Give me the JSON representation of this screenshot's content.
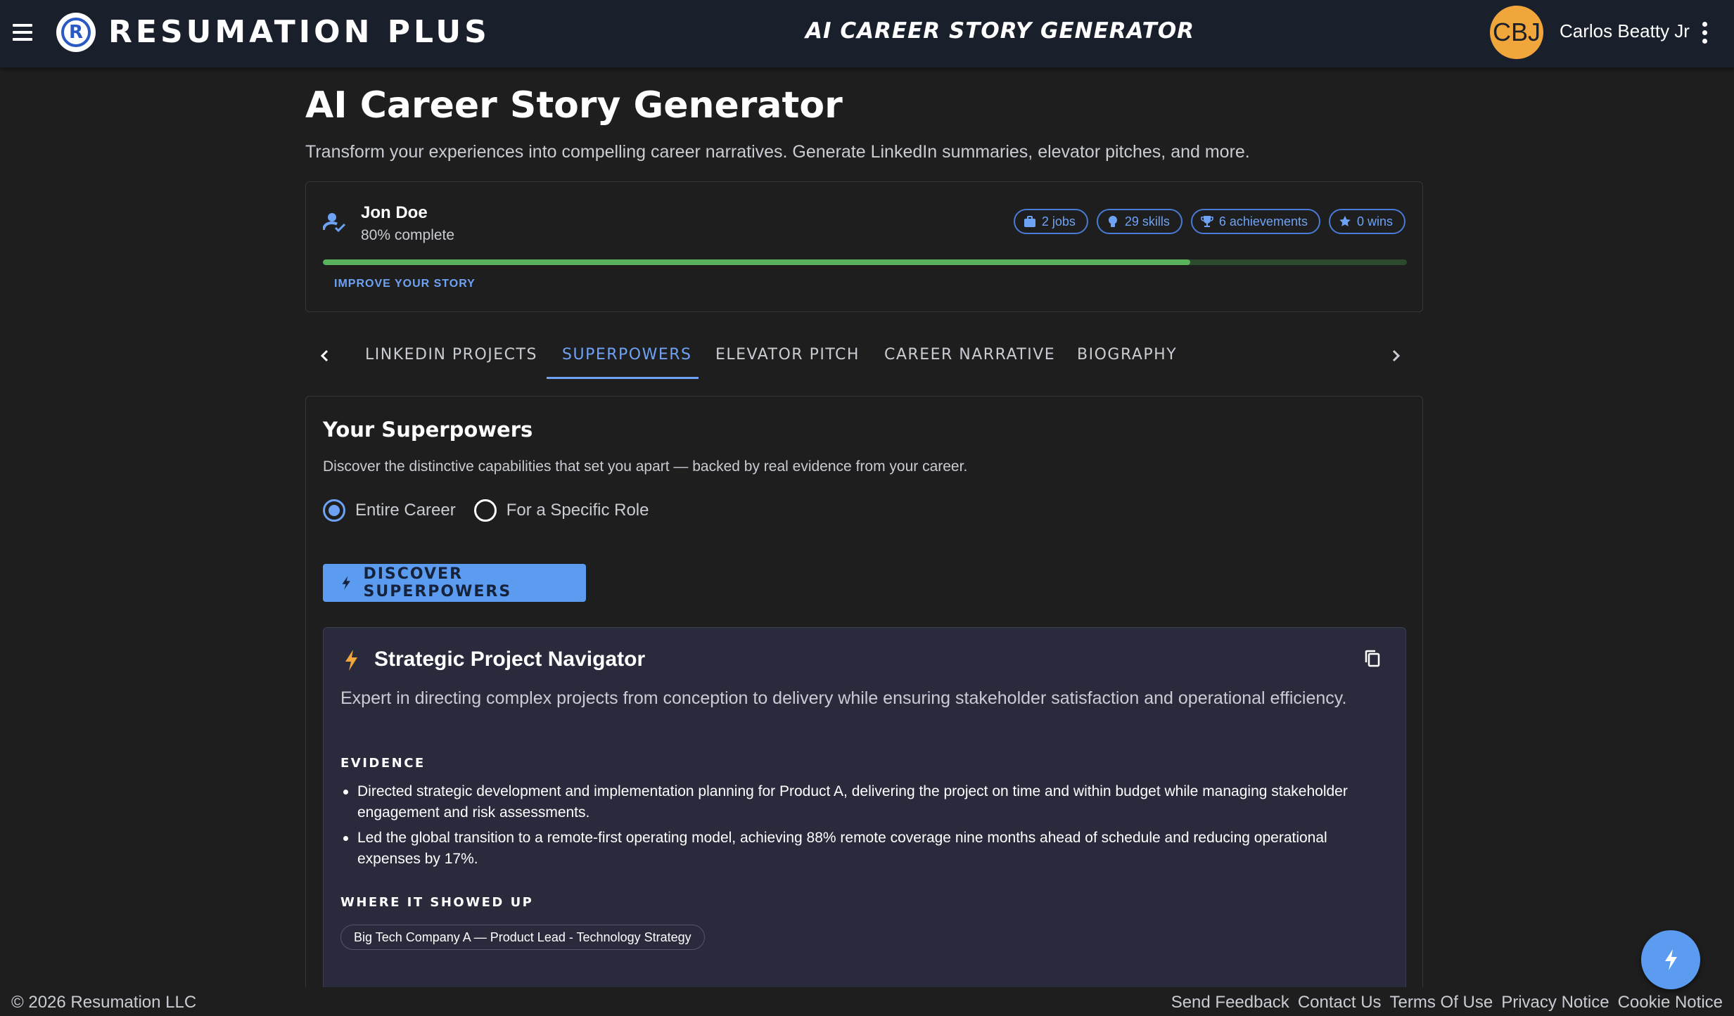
{
  "appbar": {
    "brand": "RESUMATION PLUS",
    "logo_letter": "R",
    "center_title": "AI CAREER STORY GENERATOR",
    "avatar_initials": "CBJ",
    "user_name": "Carlos Beatty Jr",
    "colors": {
      "bar": "#1a1f2c",
      "avatar": "#f0a63a",
      "logo_ring": "#2b59c3"
    },
    "icons": [
      "hamburger-menu-icon",
      "more-vert-icon"
    ]
  },
  "header": {
    "title": "AI Career Story Generator",
    "subtitle": "Transform your experiences into compelling career narratives. Generate LinkedIn summaries, elevator pitches, and more."
  },
  "profile": {
    "name": "Jon Doe",
    "complete_label": "80% complete",
    "progress": 0.8,
    "improve_link": "IMPROVE YOUR STORY",
    "chips": [
      {
        "label": "2 jobs",
        "icon": "briefcase-icon"
      },
      {
        "label": "29 skills",
        "icon": "lightbulb-icon"
      },
      {
        "label": "6 achievements",
        "icon": "trophy-icon"
      },
      {
        "label": "0 wins",
        "icon": "star-icon"
      }
    ],
    "colors": {
      "progress_fill": "#58b35a",
      "progress_track": "#2c4a2e",
      "accent": "#6ea2f5"
    }
  },
  "tabs": {
    "items": [
      {
        "label": "LINKEDIN PROJECTS",
        "active": false
      },
      {
        "label": "SUPERPOWERS",
        "active": true
      },
      {
        "label": "ELEVATOR PITCH",
        "active": false
      },
      {
        "label": "CAREER NARRATIVE",
        "active": false
      },
      {
        "label": "BIOGRAPHY",
        "active": false
      }
    ]
  },
  "superpowers": {
    "title": "Your Superpowers",
    "description": "Discover the distinctive capabilities that set you apart — backed by real evidence from your career.",
    "radio_options": [
      {
        "label": "Entire Career",
        "checked": true
      },
      {
        "label": "For a Specific Role",
        "checked": false
      }
    ],
    "discover_button": "DISCOVER SUPERPOWERS",
    "result": {
      "title": "Strategic Project Navigator",
      "summary": "Expert in directing complex projects from conception to delivery while ensuring stakeholder satisfaction and operational efficiency.",
      "evidence_label": "EVIDENCE",
      "evidence": [
        "Directed strategic development and implementation planning for Product A, delivering the project on time and within budget while managing stakeholder engagement and risk assessments.",
        "Led the global transition to a remote-first operating model, achieving 88% remote coverage nine months ahead of schedule and reducing operational expenses by 17%."
      ],
      "where_label": "WHERE IT SHOWED UP",
      "roles": [
        "Big Tech Company A — Product Lead - Technology Strategy"
      ],
      "colors": {
        "card_bg": "#2a2a3d",
        "bolt": "#f0a63a"
      }
    }
  },
  "footer": {
    "copyright": "© 2026 Resumation LLC",
    "links": [
      "Send Feedback",
      "Contact Us",
      "Terms Of Use",
      "Privacy Notice",
      "Cookie Notice"
    ]
  }
}
